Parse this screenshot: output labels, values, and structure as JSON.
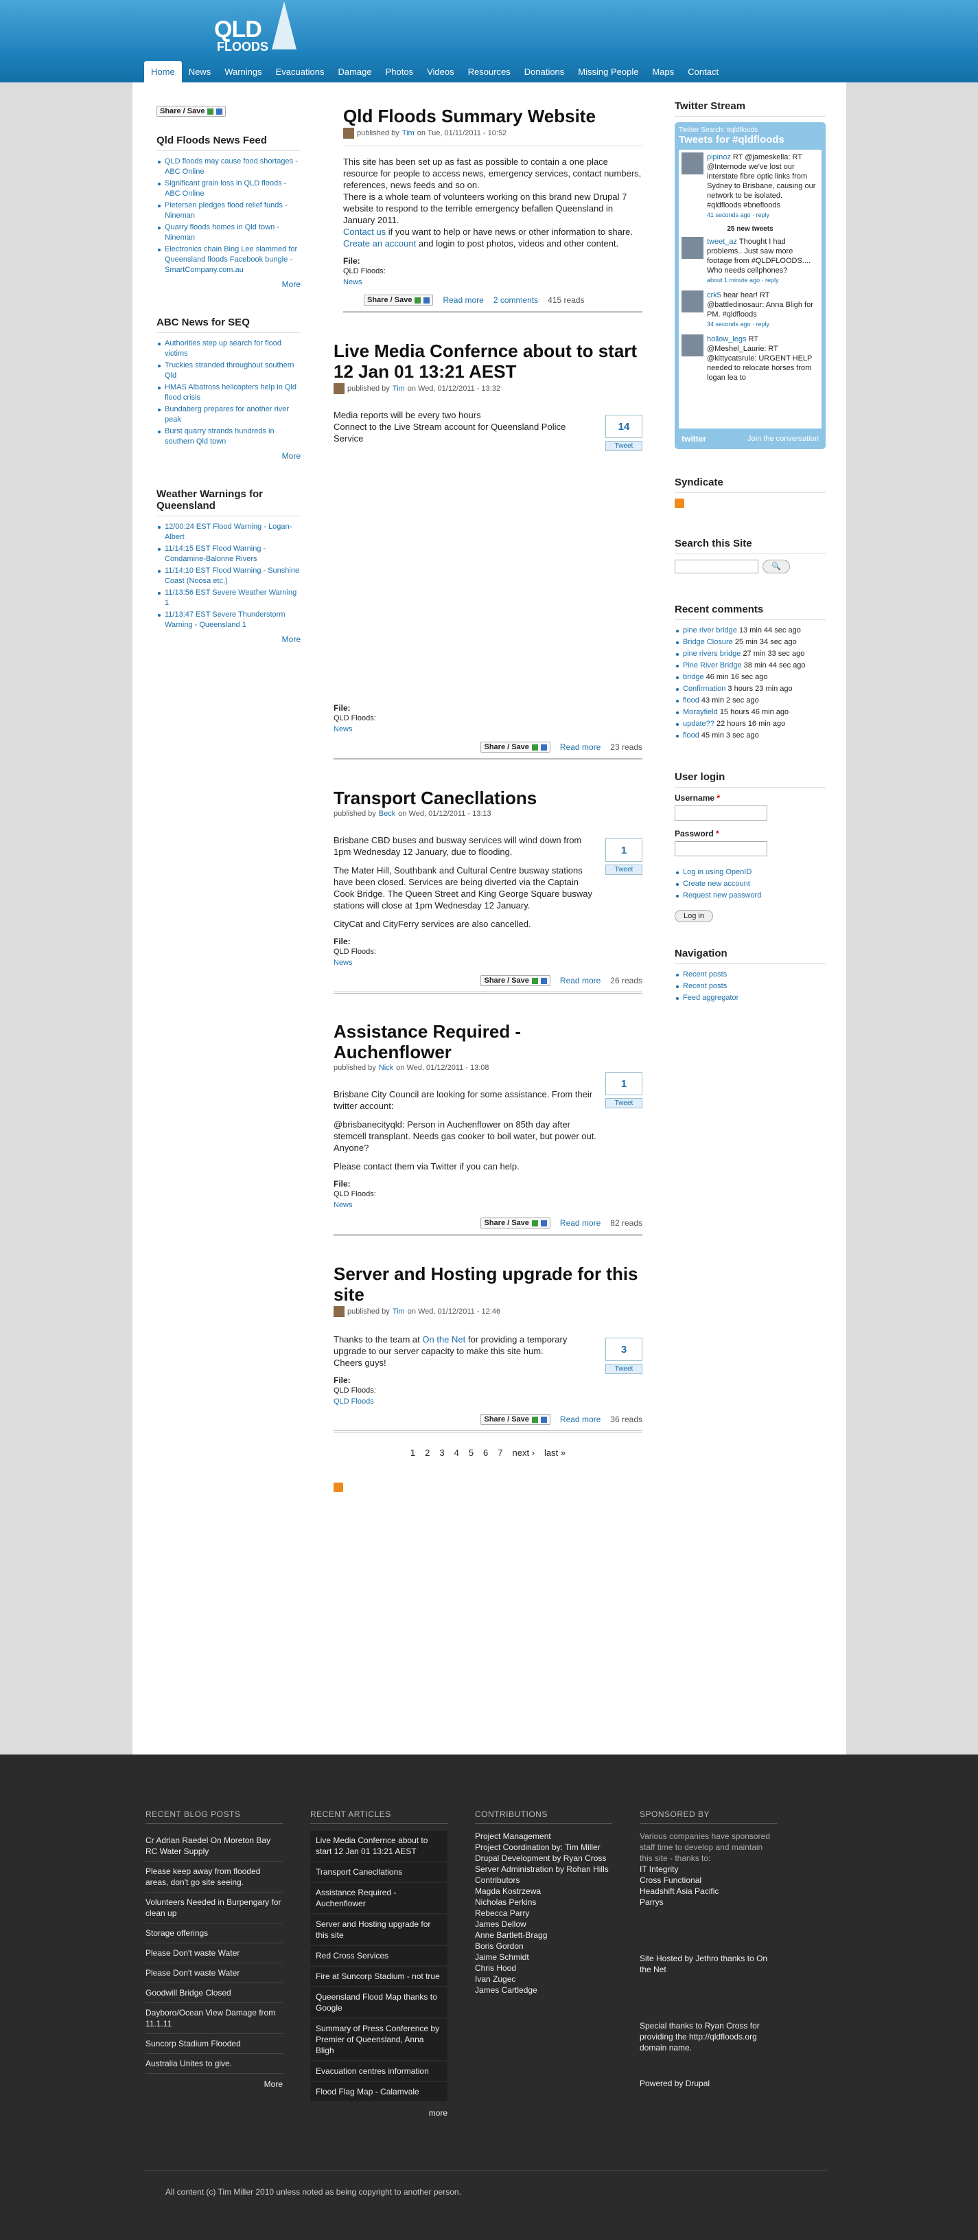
{
  "site": {
    "logo_line1": "QLD",
    "logo_line2": "FLOODS"
  },
  "nav": [
    {
      "label": "Home",
      "active": true
    },
    {
      "label": "News"
    },
    {
      "label": "Warnings"
    },
    {
      "label": "Evacuations"
    },
    {
      "label": "Damage"
    },
    {
      "label": "Photos"
    },
    {
      "label": "Videos"
    },
    {
      "label": "Resources"
    },
    {
      "label": "Donations"
    },
    {
      "label": "Missing People"
    },
    {
      "label": "Maps"
    },
    {
      "label": "Contact"
    }
  ],
  "share_label": "Share / Save",
  "left": {
    "feed1": {
      "title": "Qld Floods News Feed",
      "more": "More",
      "items": [
        "QLD floods may cause food shortages - ABC Online",
        "Significant grain loss in QLD floods - ABC Online",
        "Pietersen pledges flood relief funds - Nineman",
        "Quarry floods homes in Qld town - Nineman",
        "Electronics chain Bing Lee slammed for Queensland floods Facebook bungle - SmartCompany.com.au"
      ]
    },
    "feed2": {
      "title": "ABC News for SEQ",
      "more": "More",
      "items": [
        "Authorities step up search for flood victims",
        "Truckies stranded throughout southern Qld",
        "HMAS Albatross helicopters help in Qld flood crisis",
        "Bundaberg prepares for another river peak",
        "Burst quarry strands hundreds in southern Qld town"
      ]
    },
    "feed3": {
      "title": "Weather Warnings for Queensland",
      "more": "More",
      "items": [
        "12/00:24 EST Flood Warning - Logan-Albert",
        "11/14:15 EST Flood Warning - Condamine-Balonne Rivers",
        "11/14:10 EST Flood Warning - Sunshine Coast (Noosa etc.)",
        "11/13:56 EST Severe Weather Warning 1",
        "11/13:47 EST Severe Thunderstorm Warning - Queensland 1"
      ]
    }
  },
  "posts": [
    {
      "title": "Qld Floods Summary Website",
      "meta_pre": "published by",
      "author": "Tim",
      "date": "on Tue, 01/11/2011 - 10:52",
      "paragraphs": [
        "This site has been set up as fast as possible to contain a one place resource for people to access news, emergency services, contact numbers, references, news feeds and so on.",
        "There is a whole team of volunteers working on this brand new Drupal 7 website to respond to the terrible emergency befallen Queensland in January 2011."
      ],
      "contact_link": "Contact us",
      "contact_rest": " if you want to help or have news or other information to share.",
      "create_link": "Create an account",
      "create_rest": " and login to post photos, videos and other content.",
      "file": "File:",
      "tag_label": "QLD Floods:",
      "tag": "News",
      "read_more": "Read more",
      "comments": "2 comments",
      "reads": "415 reads"
    },
    {
      "title": "Live Media Confernce about to start 12 Jan 01 13:21 AEST",
      "meta_pre": "published by",
      "author": "Tim",
      "date": "on Wed, 01/12/2011 - 13:32",
      "paragraphs": [
        "Media reports will be every two hours",
        "Connect to the Live Stream account for Queensland Police Service"
      ],
      "tweet_count": "14",
      "tweet_label": "Tweet",
      "file": "File:",
      "tag_label": "QLD Floods:",
      "tag": "News",
      "read_more": "Read more",
      "reads": "23 reads"
    },
    {
      "title": "Transport Canecllations",
      "meta_pre": "published by",
      "author": "Beck",
      "date": "on Wed, 01/12/2011 - 13:13",
      "paragraphs": [
        "Brisbane CBD buses and busway services will wind down from 1pm Wednesday 12 January, due to flooding.",
        "The Mater Hill, Southbank and Cultural Centre busway stations have been closed. Services are being diverted via the Captain Cook Bridge. The Queen Street and King George Square busway stations will close at 1pm Wednesday 12 January.",
        "CityCat and CityFerry services are also cancelled."
      ],
      "tweet_count": "1",
      "tweet_label": "Tweet",
      "file": "File:",
      "tag_label": "QLD Floods:",
      "tag": "News",
      "read_more": "Read more",
      "reads": "26 reads"
    },
    {
      "title": "Assistance Required - Auchenflower",
      "meta_pre": "published by",
      "author": "Nick",
      "date": "on Wed, 01/12/2011 - 13:08",
      "paragraphs": [
        "Brisbane City Council are looking for some assistance. From their twitter account:",
        "@brisbanecityqld: Person in Auchenflower on 85th day after stemcell transplant. Needs gas cooker to boil water, but power out. Anyone?",
        "Please contact them via Twitter if you can help."
      ],
      "tweet_count": "1",
      "tweet_label": "Tweet",
      "file": "File:",
      "tag_label": "QLD Floods:",
      "tag": "News",
      "read_more": "Read more",
      "reads": "82 reads"
    },
    {
      "title": "Server and Hosting upgrade for this site",
      "meta_pre": "published by",
      "author": "Tim",
      "date": "on Wed, 01/12/2011 - 12:46",
      "p_pre": "Thanks to the team at ",
      "p_link": "On the Net",
      "p_post": " for providing a temporary upgrade to our server capacity to make this site hum.",
      "p2": "Cheers guys!",
      "tweet_count": "3",
      "tweet_label": "Tweet",
      "file": "File:",
      "tag_label": "QLD Floods:",
      "tag": "QLD Floods",
      "read_more": "Read more",
      "reads": "36 reads"
    }
  ],
  "pager": [
    "1",
    "2",
    "3",
    "4",
    "5",
    "6",
    "7",
    "next ›",
    "last »"
  ],
  "right": {
    "twitter_title": "Twitter Stream",
    "widget_search": "Twitter Search: #qldfloods",
    "widget_head": "Tweets for #qldfloods",
    "tweets": [
      {
        "user": "pipinoz",
        "text": "RT @jameskella: RT @Internode we've lost our interstate fibre optic links from Sydney to Brisbane, causing our network to be isolated. #qldfloods #bnefloods",
        "time": "41 seconds ago · reply"
      },
      {
        "user": "tweet_az",
        "text": "Thought I had problems.. Just saw more footage from #QLDFLOODS.... Who needs cellphones?",
        "time": "about 1 minute ago · reply"
      },
      {
        "user": "crk5",
        "text": "hear hear! RT @battledinosaur: Anna Bligh for PM. #qldfloods",
        "time": "34 seconds ago · reply"
      },
      {
        "user": "hollow_legs",
        "text": "RT @Meshel_Laurie: RT @kittycatsrule: URGENT HELP needed to relocate horses from logan lea to",
        "time": ""
      }
    ],
    "new_tweets": "25 new tweets",
    "widget_brand": "twitter",
    "widget_join": "Join the conversation",
    "syndicate": "Syndicate",
    "search_title": "Search this Site",
    "recent_title": "Recent comments",
    "recent": [
      {
        "link": "pine river bridge",
        "ago": "13 min 44 sec ago"
      },
      {
        "link": "Bridge Closure",
        "ago": "25 min 34 sec ago"
      },
      {
        "link": "pine rivers bridge",
        "ago": "27 min 33 sec ago"
      },
      {
        "link": "Pine River Bridge",
        "ago": "38 min 44 sec ago"
      },
      {
        "link": "bridge",
        "ago": "46 min 16 sec ago"
      },
      {
        "link": "Confirmation",
        "ago": "3 hours 23 min ago"
      },
      {
        "link": "flood",
        "ago": "43 min 2 sec ago"
      },
      {
        "link": "Morayfield",
        "ago": "15 hours 46 min ago"
      },
      {
        "link": "update??",
        "ago": "22 hours 16 min ago"
      },
      {
        "link": "flood",
        "ago": "45 min 3 sec ago"
      }
    ],
    "login_title": "User login",
    "username_label": "Username",
    "password_label": "Password",
    "required": "*",
    "openid": "Log in using OpenID",
    "create": "Create new account",
    "request": "Request new password",
    "login_btn": "Log in",
    "navigation_title": "Navigation",
    "navigation": [
      "Recent posts",
      "Recent posts",
      "Feed aggregator"
    ]
  },
  "footer": {
    "blog_title": "RECENT BLOG POSTS",
    "blog": [
      "Cr Adrian Raedel On Moreton Bay RC Water Supply",
      "Please keep away from flooded areas, don't go site seeing.",
      "Volunteers Needed in Burpengary for clean up",
      "Storage offerings",
      "Please Don't waste Water",
      "Please Don't waste Water",
      "Goodwill Bridge Closed",
      "Dayboro/Ocean View Damage from 11.1.11",
      "Suncorp Stadium Flooded",
      "Australia Unites to give."
    ],
    "blog_more": "More",
    "articles_title": "RECENT ARTICLES",
    "articles": [
      "Live Media Confernce about to start 12 Jan 01 13:21 AEST",
      "Transport Canecllations",
      "Assistance Required - Auchenflower",
      "Server and Hosting upgrade for this site",
      "Red Cross Services",
      "Fire at Suncorp Stadium - not true",
      "Queensland Flood Map thanks to Google",
      "Summary of Press Conference by Premier of Queensland, Anna Bligh",
      "Evacuation centres information",
      "Flood Flag Map - Calamvale"
    ],
    "articles_more": "more",
    "contrib_title": "CONTRIBUTIONS",
    "contrib": [
      "Project Management",
      "Project Coordination by: Tim Miller",
      "Drupal Development by Ryan Cross",
      "Server Administration by Rohan Hills",
      "Contributors",
      "Magda Kostrzewa",
      "Nicholas Perkins",
      "Rebecca Parry",
      "James Dellow",
      "Anne Bartlett-Bragg",
      "Boris Gordon",
      "Jaime Schmidt",
      "Chris Hood",
      "Ivan Zugec",
      "James Cartledge"
    ],
    "sponsor_title": "SPONSORED BY",
    "sponsor_text": "Various companies have sponsored staff time to develop and maintain this site - thanks to:",
    "sponsors": [
      "IT Integrity",
      "Cross Functional",
      "Headshift Asia Pacific",
      "Parrys"
    ],
    "hosted": "Site Hosted by Jethro thanks to On the Net",
    "thanks": "Special thanks to Ryan Cross for providing the http://qldfloods.org domain name.",
    "powered": "Powered by Drupal",
    "copyright": "All content (c) Tim Miller 2010 unless noted as being copyright to another person."
  }
}
